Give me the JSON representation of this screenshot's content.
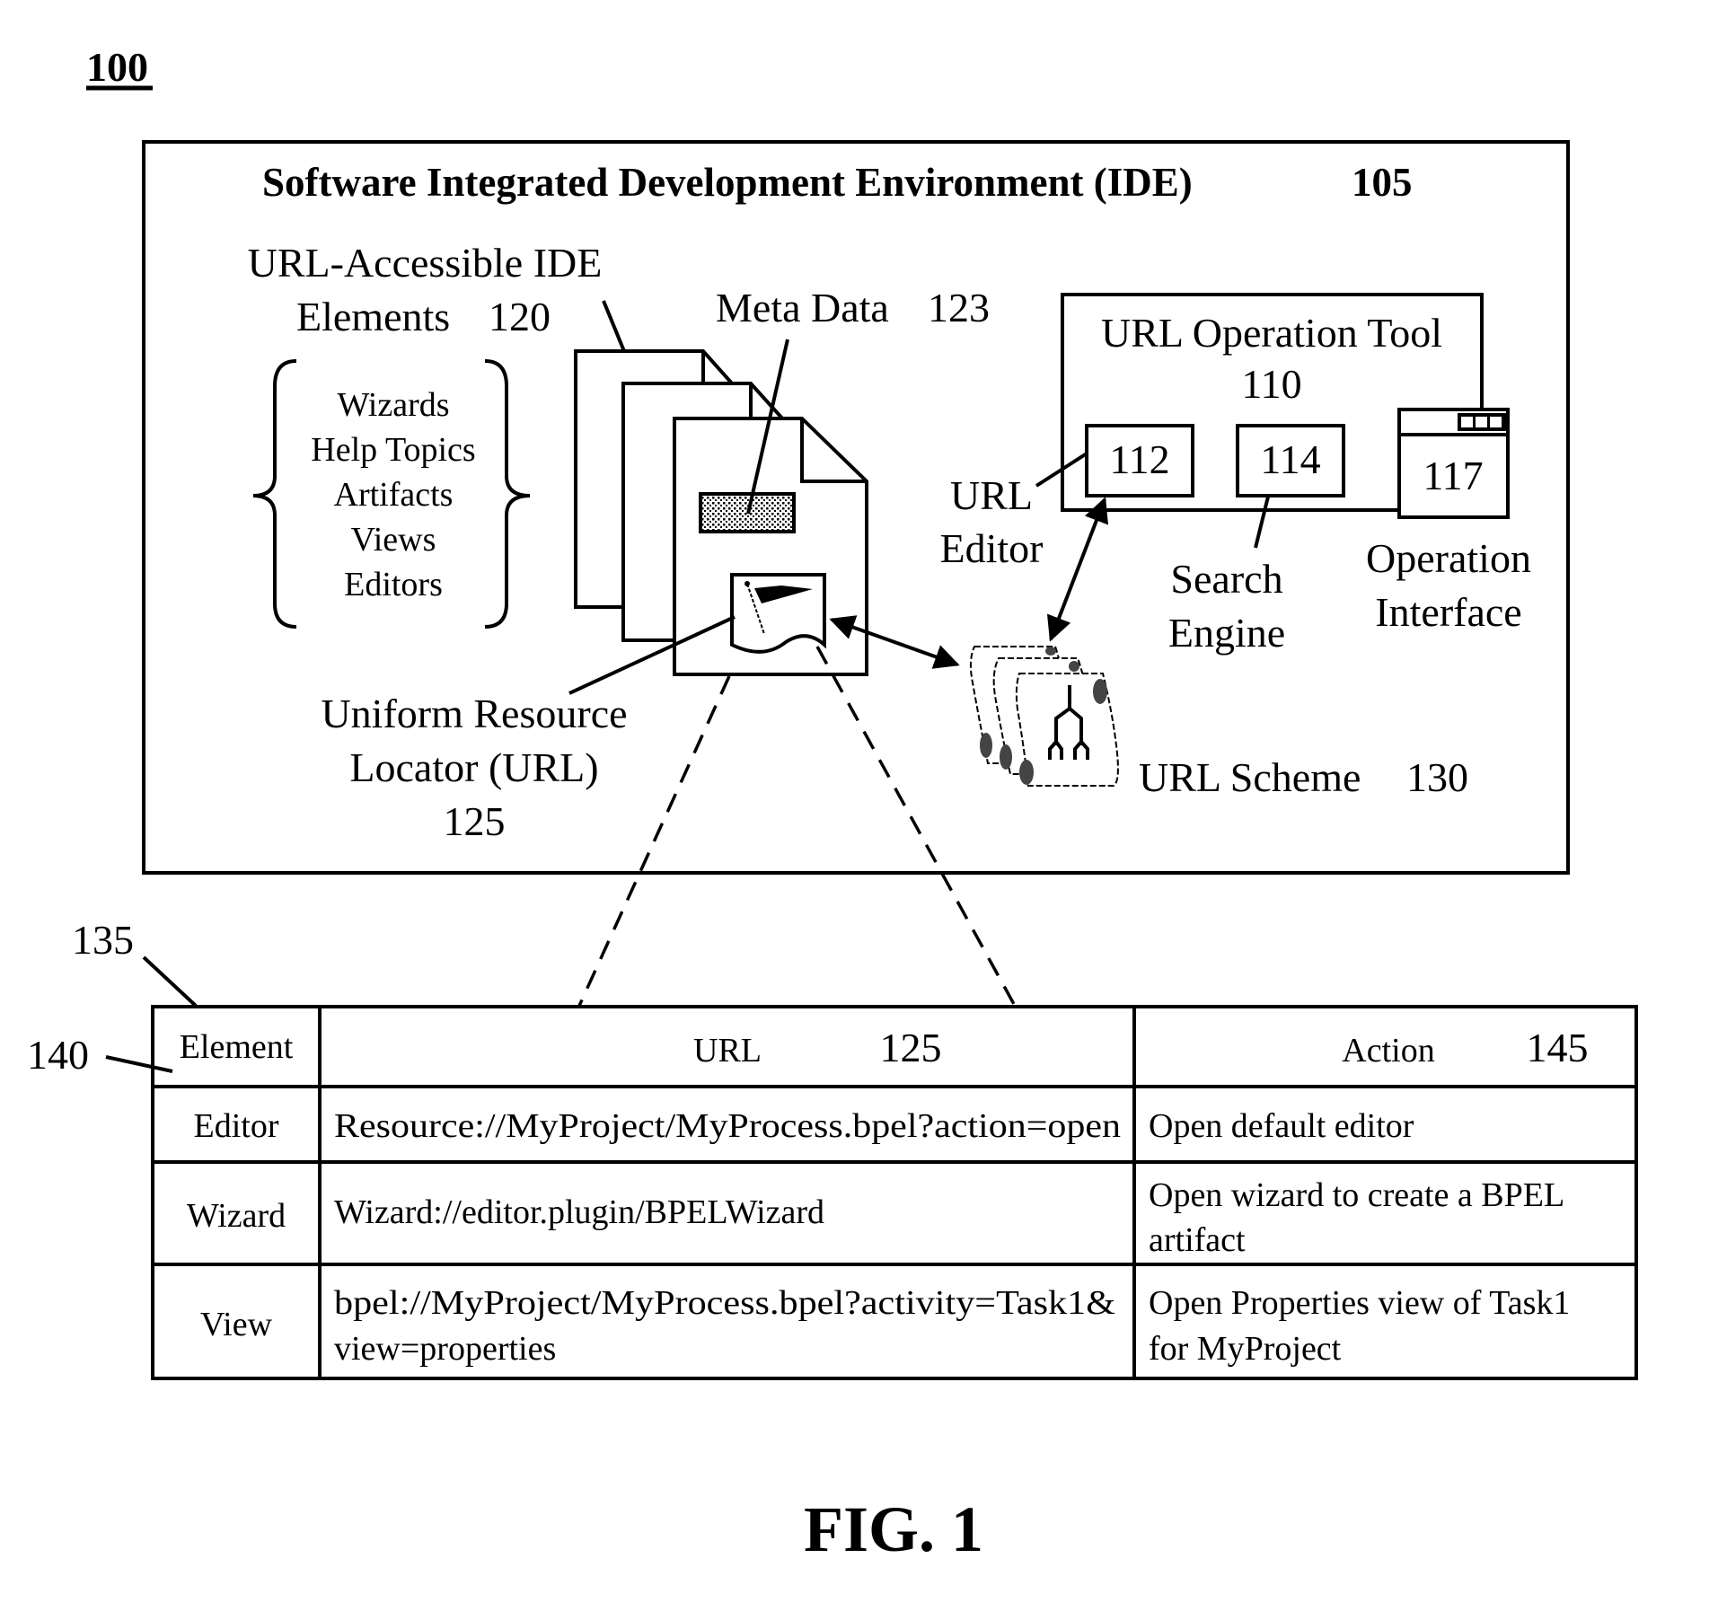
{
  "figure": {
    "number_label": "100",
    "caption": "FIG. 1"
  },
  "ide": {
    "title": "Software Integrated Development Environment (IDE)",
    "ref": "105",
    "elements": {
      "label_line1": "URL-Accessible IDE",
      "label_line2": "Elements",
      "ref": "120",
      "items": [
        "Wizards",
        "Help Topics",
        "Artifacts",
        "Views",
        "Editors"
      ]
    },
    "meta_data": {
      "label": "Meta Data",
      "ref": "123"
    },
    "url": {
      "line1": "Uniform Resource",
      "line2": "Locator (URL)",
      "ref": "125"
    },
    "tool": {
      "label": "URL Operation Tool",
      "ref": "110",
      "url_editor": {
        "ref": "112",
        "label_line1": "URL",
        "label_line2": "Editor"
      },
      "search_engine": {
        "ref": "114",
        "label_line1": "Search",
        "label_line2": "Engine"
      },
      "operation_interface": {
        "ref": "117",
        "label_line1": "Operation",
        "label_line2": "Interface"
      }
    },
    "scheme": {
      "label": "URL Scheme",
      "ref": "130"
    }
  },
  "table": {
    "ref": "135",
    "header_ref": "140",
    "headers": [
      {
        "label": "Element",
        "ref": ""
      },
      {
        "label": "URL",
        "ref": "125"
      },
      {
        "label": "Action",
        "ref": "145"
      }
    ],
    "rows": [
      {
        "element": "Editor",
        "url": [
          "Resource://MyProject/MyProcess.bpel?action=open"
        ],
        "action": [
          "Open default editor"
        ]
      },
      {
        "element": "Wizard",
        "url": [
          "Wizard://editor.plugin/BPELWizard"
        ],
        "action": [
          "Open wizard to create a BPEL",
          "artifact"
        ]
      },
      {
        "element": "View",
        "url": [
          "bpel://MyProject/MyProcess.bpel?activity=Task1&",
          "view=properties"
        ],
        "action": [
          "Open Properties view of Task1",
          "for MyProject"
        ]
      }
    ]
  }
}
